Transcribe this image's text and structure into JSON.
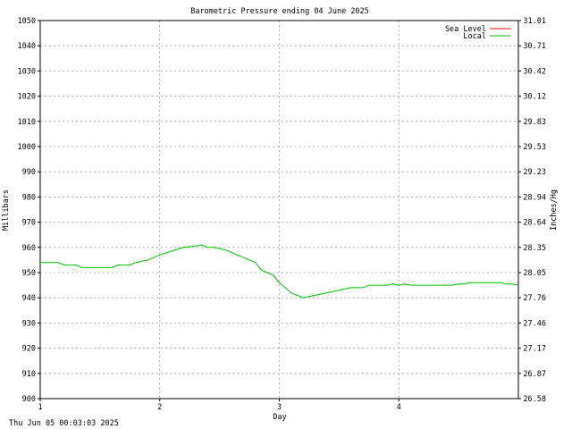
{
  "chart_data": {
    "type": "line",
    "title": "Barometric Pressure ending 04 June 2025",
    "xlabel": "Day",
    "ylabel": "Millibars",
    "y2label": "Inches/Hg",
    "xlim": [
      1,
      5
    ],
    "ylim": [
      900,
      1050
    ],
    "x_ticks": [
      "1",
      "2",
      "3",
      "4"
    ],
    "y_ticks": [
      "1050",
      "1040",
      "1030",
      "1020",
      "1010",
      "1000",
      "990",
      "980",
      "970",
      "960",
      "950",
      "940",
      "930",
      "920",
      "910",
      "900"
    ],
    "y2_ticks": [
      "31.01",
      "30.71",
      "30.42",
      "30.12",
      "29.83",
      "29.53",
      "29.23",
      "28.94",
      "28.64",
      "28.35",
      "28.05",
      "27.76",
      "27.46",
      "27.17",
      "26.87",
      "26.58"
    ],
    "grid": true,
    "legend_position": "top-right",
    "series": [
      {
        "name": "Sea Level",
        "color": "#ff0000",
        "x": [],
        "y": []
      },
      {
        "name": "Local",
        "color": "#00c000",
        "x": [
          1.0,
          1.15,
          1.2,
          1.3,
          1.35,
          1.55,
          1.6,
          1.65,
          1.75,
          1.8,
          1.9,
          2.0,
          2.1,
          2.2,
          2.3,
          2.35,
          2.4,
          2.45,
          2.55,
          2.6,
          2.7,
          2.8,
          2.85,
          2.9,
          2.95,
          3.0,
          3.1,
          3.2,
          3.3,
          3.4,
          3.5,
          3.6,
          3.7,
          3.75,
          3.85,
          3.9,
          3.95,
          4.0,
          4.05,
          4.1,
          4.2,
          4.3,
          4.35,
          4.45,
          4.5,
          4.55,
          4.6,
          4.65,
          4.7,
          4.75,
          4.85,
          4.9,
          4.95,
          5.0
        ],
        "y": [
          954,
          954,
          953,
          953,
          952,
          952,
          952,
          953,
          953,
          954,
          955,
          957,
          958.5,
          960,
          960.5,
          961,
          960,
          960,
          959,
          958,
          956,
          954,
          951,
          950,
          949,
          946,
          942,
          940,
          941,
          942,
          943,
          944,
          944,
          945,
          945,
          945,
          945.5,
          945,
          945.5,
          945,
          945,
          945,
          945,
          945,
          945.5,
          945.5,
          946,
          946,
          946,
          946,
          946,
          945.5,
          945.5,
          945
        ]
      }
    ]
  },
  "footer": {
    "timestamp": "Thu Jun 05 00:03:03 2025"
  }
}
